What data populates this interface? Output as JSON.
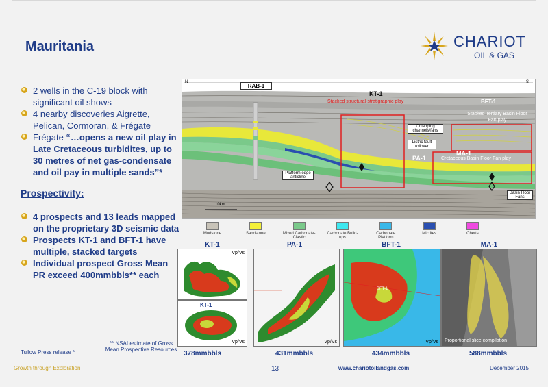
{
  "title": "Mauritania",
  "brand": {
    "name": "CHARIOT",
    "tagline": "OIL & GAS",
    "color": "#1f3c88",
    "gold": "#d7a51c"
  },
  "bullets_top": [
    {
      "text": "2 wells in the C-19 block with significant oil shows",
      "bold": false
    },
    {
      "text": "4 nearby discoveries Aigrette, Pelican, Cormoran, & Frégate",
      "bold": false
    }
  ],
  "bullet_fregate": {
    "prefix": "Frégate ",
    "quote": "“…opens a new oil play in Late Cretaceous turbidites, up to 30 metres of net gas-condensate and oil pay in multiple sands”*"
  },
  "prospectivity_heading": "Prospectivity:",
  "bullets_bottom": [
    "4 prospects and 13 leads mapped on the proprietary 3D seismic data",
    "Prospects KT-1 and BFT-1 have multiple, stacked targets",
    "Individual prospect Gross Mean PR exceed 400mmbbls** each"
  ],
  "footnote_tullow": "Tullow Press release *",
  "footnote_nsai": "** NSAI estimate of Gross Mean Prospective Resources",
  "seismic": {
    "compass_left": "N",
    "compass_right": "S",
    "well_label": "RAB-1",
    "kt1_label": "KT-1",
    "kt1_play": "Stacked structural-stratigraphic play",
    "bft1_label": "BFT-1",
    "bft1_play": "Stacked Tertiary Basin Floor Fan play",
    "ma1_label": "MA-1",
    "ma1_play": "Cretaceous Basin Floor Fan play",
    "pa1_label": "PA-1",
    "ann_channels": "Onlapping channels/fans",
    "ann_rollover": "Listric fault rollover",
    "ann_anticline": "Platform edge anticline",
    "ann_bff": "Basin Floor Fans",
    "scale": "10km"
  },
  "legend": [
    {
      "label": "Mudstone",
      "color": "#c8c3b8"
    },
    {
      "label": "Sandstone",
      "color": "#f4f03a"
    },
    {
      "label": "Mixed Carbonate-Clastic",
      "color": "#7ac98a"
    },
    {
      "label": "Carbonate Build-ups",
      "color": "#3ee8f0"
    },
    {
      "label": "Carbonate Platform",
      "color": "#39b8e8"
    },
    {
      "label": "Micrites",
      "color": "#2a4fb0"
    },
    {
      "label": "Cherts",
      "color": "#f04ae0"
    }
  ],
  "maps": [
    {
      "label": "KT-1",
      "vpvs": "Vp/Vs",
      "resources": "378mmbbls"
    },
    {
      "label": "PA-1",
      "vpvs": "Vp/Vs",
      "resources": "431mmbbls"
    },
    {
      "label": "BFT-1",
      "vpvs": "Vp/Vs",
      "inner": "BFT-1",
      "resources": "434mmbbls"
    },
    {
      "label": "MA-1",
      "caption": "Proportional slice compilation",
      "resources": "588mmbbls"
    }
  ],
  "kt1_lower": {
    "label": "KT-1",
    "vpvs": "Vp/Vs"
  },
  "footer": {
    "left": "Growth through Exploration",
    "page": "13",
    "url": "www.chariotoilandgas.com",
    "date": "December 2015"
  }
}
